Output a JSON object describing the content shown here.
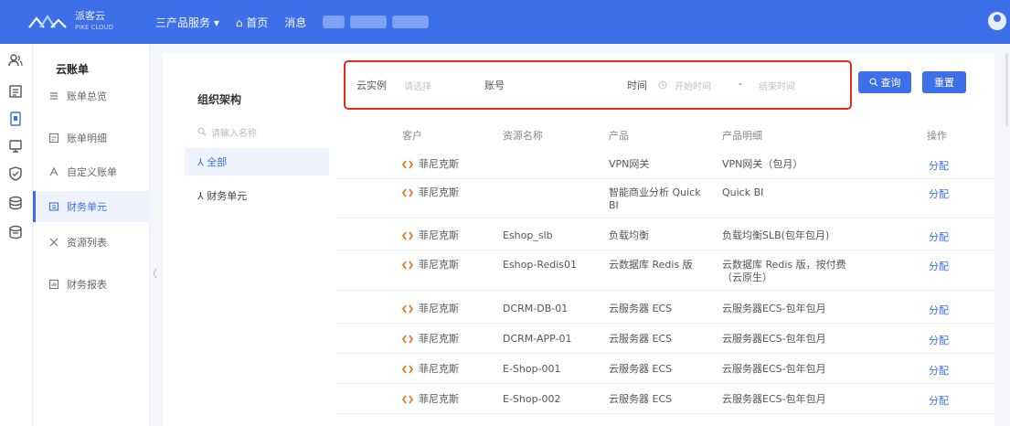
{
  "topbar": {
    "brand_name": "派客云",
    "brand_sub": "PIKE CLOUD",
    "nav": [
      {
        "label": "三产品服务 ▾"
      },
      {
        "label": "⌂ 首页"
      },
      {
        "label": "消息"
      }
    ],
    "accent": "#3d6fe8"
  },
  "rail": {
    "icons": [
      "users-icon",
      "bill-icon",
      "document-icon",
      "monitor-icon",
      "shield-icon",
      "database-icon",
      "layers-icon"
    ]
  },
  "submenu": {
    "title": "云账单",
    "items": [
      {
        "label": "账单总览",
        "icon": "list-icon"
      },
      {
        "label": "账单明细",
        "icon": "detail-icon"
      },
      {
        "label": "自定义账单",
        "icon": "custom-icon"
      },
      {
        "label": "财务单元",
        "icon": "finance-icon",
        "active": true
      },
      {
        "label": "资源列表",
        "icon": "resource-icon"
      },
      {
        "label": "财务报表",
        "icon": "report-icon"
      }
    ]
  },
  "tree": {
    "title": "组织架构",
    "search_placeholder": "请输入名称",
    "nodes": [
      {
        "label": "⅄ 全部",
        "selected": true
      },
      {
        "label": "⅄ 财务单元"
      }
    ]
  },
  "filter": {
    "cloud_label": "云实例",
    "cloud_placeholder": "请选择",
    "account_label": "账号",
    "time_label": "时间",
    "start_placeholder": "开始时间",
    "range_sep": "-",
    "end_placeholder": "结束时间",
    "search_button": "查询",
    "reset_button": "重置"
  },
  "table": {
    "headers": [
      "客户",
      "资源名称",
      "产品",
      "产品明细",
      "操作"
    ],
    "rows": [
      {
        "customer": "菲尼克斯",
        "resource": "",
        "product": "VPN网关",
        "detail": "VPN网关（包月）",
        "op": "分配"
      },
      {
        "customer": "菲尼克斯",
        "resource": "",
        "product": "智能商业分析 Quick BI",
        "detail": "Quick BI",
        "op": "分配"
      },
      {
        "customer": "菲尼克斯",
        "resource": "Eshop_slb",
        "product": "负载均衡",
        "detail": "负载均衡SLB(包年包月)",
        "op": "分配"
      },
      {
        "customer": "菲尼克斯",
        "resource": "Eshop-Redis01",
        "product": "云数据库 Redis 版",
        "detail": "云数据库 Redis 版，按付费（云原生）",
        "op": "分配"
      },
      {
        "customer": "菲尼克斯",
        "resource": "DCRM-DB-01",
        "product": "云服务器 ECS",
        "detail": "云服务器ECS-包年包月",
        "op": "分配"
      },
      {
        "customer": "菲尼克斯",
        "resource": "DCRM-APP-01",
        "product": "云服务器 ECS",
        "detail": "云服务器ECS-包年包月",
        "op": "分配"
      },
      {
        "customer": "菲尼克斯",
        "resource": "E-Shop-001",
        "product": "云服务器 ECS",
        "detail": "云服务器ECS-包年包月",
        "op": "分配"
      },
      {
        "customer": "菲尼克斯",
        "resource": "E-Shop-002",
        "product": "云服务器 ECS",
        "detail": "云服务器ECS-包年包月",
        "op": "分配"
      }
    ]
  }
}
